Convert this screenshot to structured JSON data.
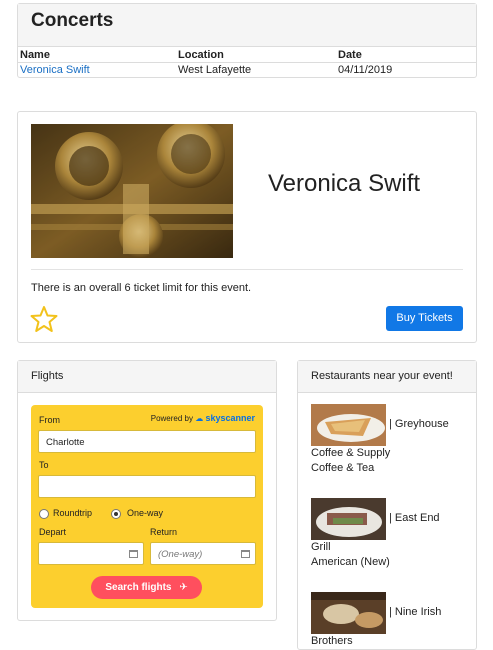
{
  "concerts": {
    "title": "Concerts",
    "columns": [
      "Name",
      "Location",
      "Date"
    ],
    "rows": [
      {
        "name": "Veronica Swift",
        "location": "West Lafayette",
        "date": "04/11/2019"
      }
    ]
  },
  "event": {
    "title": "Veronica Swift",
    "ticket_limit_text": "There is an overall 6 ticket limit for this event.",
    "buy_label": "Buy Tickets"
  },
  "flights": {
    "header": "Flights",
    "powered_by": "Powered by",
    "brand": "skyscanner",
    "from_label": "From",
    "from_value": "Charlotte",
    "to_label": "To",
    "to_value": "",
    "roundtrip_label": "Roundtrip",
    "oneway_label": "One-way",
    "depart_label": "Depart",
    "return_label": "Return",
    "return_placeholder": "(One-way)",
    "search_label": "Search flights"
  },
  "restaurants": {
    "header": "Restaurants near your event!",
    "items": [
      {
        "name_line": "| Greyhouse",
        "name_rest": "Coffee & Supply",
        "cuisine": "Coffee & Tea"
      },
      {
        "name_line": "| East End",
        "name_rest": "Grill",
        "cuisine": "American (New)"
      },
      {
        "name_line": "| Nine Irish",
        "name_rest": "Brothers",
        "cuisine": ""
      }
    ]
  },
  "colors": {
    "accent": "#1178e6",
    "link": "#1a6fc4",
    "widget_bg": "#fccf2e",
    "search_button": "#ff4f5e"
  }
}
